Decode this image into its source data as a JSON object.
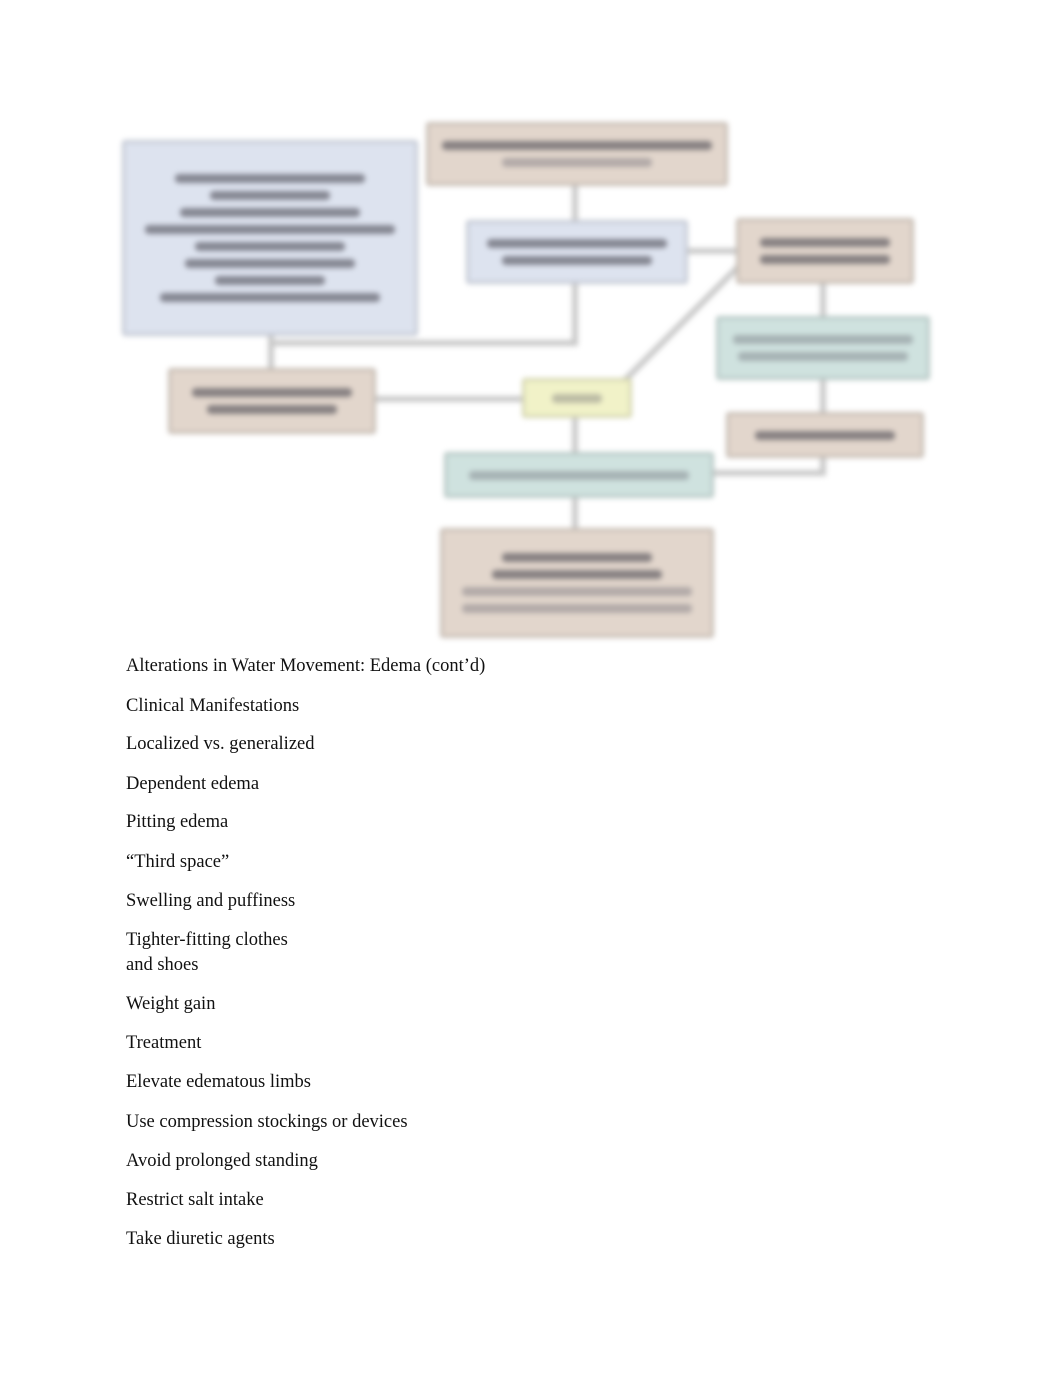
{
  "diagram": {
    "note": "flowchart (labels blurred, not legible)",
    "colors": {
      "blue_box": "#dde3ef",
      "tan_box": "#e2d6cc",
      "teal_box": "#cfe2df",
      "yellow_box": "#f1f2c8",
      "connector": "#c4c4c4"
    }
  },
  "content": {
    "title": "Alterations in Water Movement: Edema (cont’d)",
    "items": [
      "Clinical Manifestations",
      "Localized vs. generalized",
      "Dependent edema",
      "Pitting edema",
      "“Third space”",
      "Swelling and puffiness",
      "Tighter-fitting clothes\nand shoes",
      "Weight gain",
      "Treatment",
      "Elevate edematous limbs",
      "Use compression stockings or devices",
      "Avoid prolonged standing",
      "Restrict salt intake",
      "Take diuretic agents"
    ]
  }
}
